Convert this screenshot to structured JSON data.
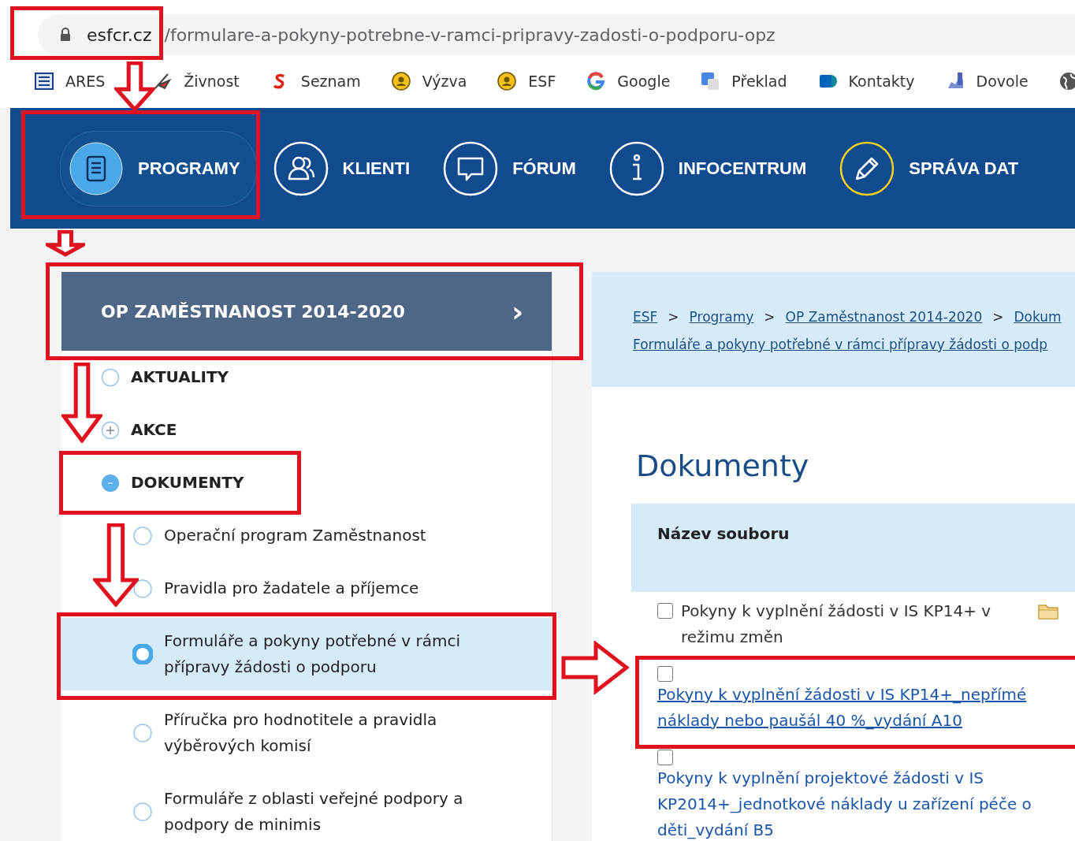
{
  "browser": {
    "url_host": "esfcr.cz",
    "url_path": "/formulare-a-pokyny-potrebne-v-ramci-pripravy-zadosti-o-podporu-opz",
    "bookmarks": [
      {
        "label": "ARES"
      },
      {
        "label": "Živnost"
      },
      {
        "label": "Seznam"
      },
      {
        "label": "Výzva"
      },
      {
        "label": "ESF"
      },
      {
        "label": "Google"
      },
      {
        "label": "Překlad"
      },
      {
        "label": "Kontakty"
      },
      {
        "label": "Dovole"
      }
    ]
  },
  "nav": [
    {
      "label": "PROGRAMY",
      "selected": true,
      "color": "#ffffff"
    },
    {
      "label": "KLIENTI",
      "selected": false,
      "color": "#ffffff"
    },
    {
      "label": "FÓRUM",
      "selected": false,
      "color": "#ffffff"
    },
    {
      "label": "INFOCENTRUM",
      "selected": false,
      "color": "#ffffff"
    },
    {
      "label": "SPRÁVA DAT",
      "selected": false,
      "color": "#f2d21b"
    }
  ],
  "sidebar": {
    "title": "OP ZAMĚSTNANOST 2014-2020",
    "chevron": "›",
    "items": [
      {
        "label": "AKTUALITY",
        "kind": "leaf"
      },
      {
        "label": "AKCE",
        "kind": "group",
        "expanded": false
      },
      {
        "label": "DOKUMENTY",
        "kind": "group",
        "expanded": true,
        "children": [
          {
            "label": "Operační program Zaměstnanost",
            "selected": false
          },
          {
            "label": "Pravidla pro žadatele a příjemce",
            "selected": false
          },
          {
            "label": "Formuláře a pokyny potřebné v rámci přípravy žádosti o podporu",
            "selected": true
          },
          {
            "label": "Příručka pro hodnotitele a pravidla výběrových komisí",
            "selected": false
          },
          {
            "label": "Formuláře z oblasti veřejné podpory a podpory de minimis",
            "selected": false
          }
        ]
      }
    ]
  },
  "breadcrumb": [
    {
      "label": "ESF"
    },
    {
      "label": "Programy"
    },
    {
      "label": "OP Zaměstnanost 2014-2020"
    },
    {
      "label": "Dokum"
    }
  ],
  "breadcrumb_separator": ">",
  "breadcrumb_current": "Formuláře a pokyny potřebné v rámci přípravy žádosti o podp",
  "heading": "Dokumenty",
  "table": {
    "column": "Název souboru",
    "rows": [
      {
        "name": "Pokyny k vyplnění žádosti v IS KP14+ v režimu změn",
        "kind": "text",
        "checked": false,
        "folder": true
      },
      {
        "name": "Pokyny k vyplnění žádosti v IS KP14+_nepřímé náklady nebo paušál 40 %_vydání A10",
        "kind": "link",
        "checked": false,
        "folder": false
      },
      {
        "name": "Pokyny k vyplnění projektové žádosti v IS KP2014+_jednotkové náklady u zařízení péče o děti_vydání B5",
        "kind": "label",
        "checked": false,
        "folder": false
      }
    ]
  }
}
